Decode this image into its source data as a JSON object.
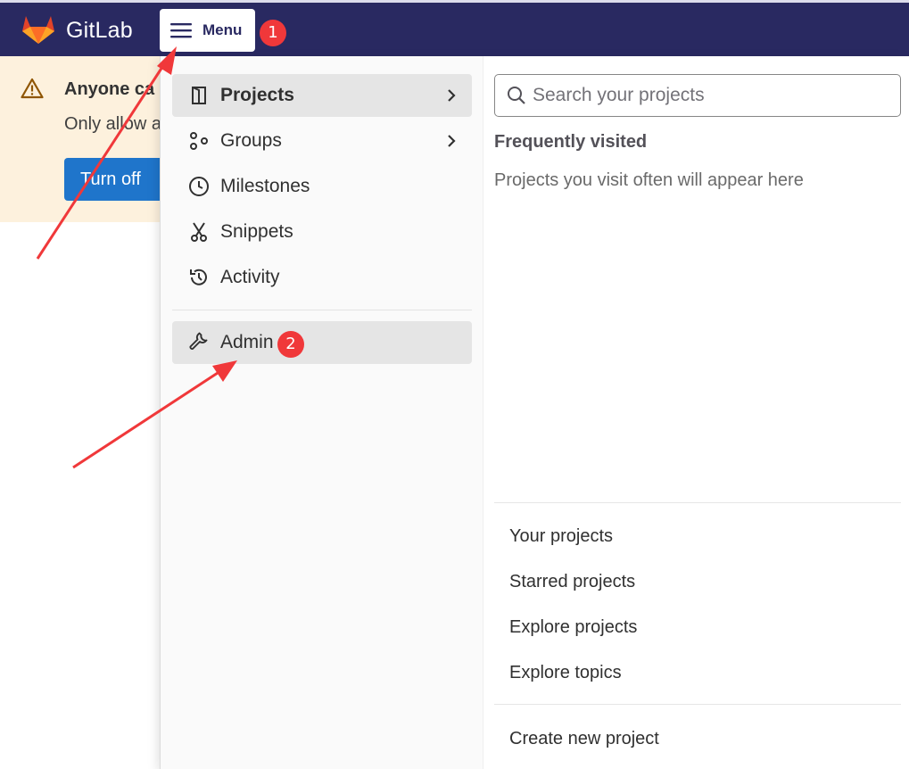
{
  "topbar": {
    "brand": "GitLab",
    "menu_label": "Menu"
  },
  "banner": {
    "title": "Anyone ca",
    "text": "Only allow a",
    "button_label": "Turn off"
  },
  "dropdown": {
    "nav_items": [
      {
        "label": "Projects",
        "icon": "project-icon",
        "active": true
      },
      {
        "label": "Groups",
        "icon": "group-icon",
        "active": false
      },
      {
        "label": "Milestones",
        "icon": "clock-icon",
        "active": false
      },
      {
        "label": "Snippets",
        "icon": "scissors-icon",
        "active": false
      },
      {
        "label": "Activity",
        "icon": "history-icon",
        "active": false
      },
      {
        "label": "Admin",
        "icon": "wrench-icon",
        "active": false
      }
    ],
    "search": {
      "placeholder": "Search your projects",
      "value": ""
    },
    "frequently_visited_title": "Frequently visited",
    "frequently_visited_empty": "Projects you visit often will appear here",
    "links": [
      "Your projects",
      "Starred projects",
      "Explore projects",
      "Explore topics"
    ],
    "create_link": "Create new project"
  },
  "annotations": {
    "badge_1": "1",
    "badge_2": "2",
    "badge_color": "#f0383a",
    "arrow_color": "#f0383a"
  },
  "colors": {
    "topbar": "#292961",
    "banner": "#fdf1dd",
    "primary_button": "#1f75cb"
  }
}
